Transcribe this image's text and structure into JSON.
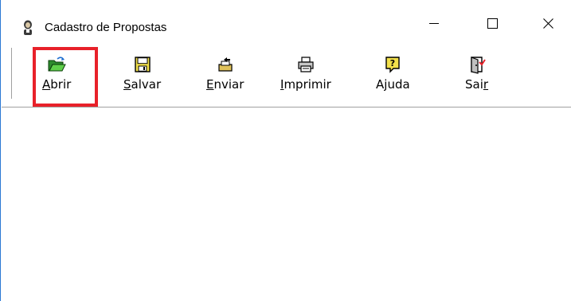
{
  "window": {
    "title": "Cadastro de Propostas",
    "icon": "person-icon"
  },
  "window_controls": {
    "minimize_icon": "minimize-icon",
    "maximize_icon": "maximize-icon",
    "close_icon": "close-icon"
  },
  "toolbar": {
    "buttons": [
      {
        "label_mn": "A",
        "label_rest": "brir",
        "icon": "folder-open-icon",
        "selected": true
      },
      {
        "label_mn": "S",
        "label_rest": "alvar",
        "icon": "save-icon"
      },
      {
        "label_mn": "E",
        "label_rest": "nviar",
        "icon": "send-icon"
      },
      {
        "label_mn": "I",
        "label_rest": "mprimir",
        "icon": "printer-icon"
      },
      {
        "label_pre": "A",
        "label_mn": "j",
        "label_rest": "uda",
        "icon": "help-icon"
      },
      {
        "label_pre": "Sai",
        "label_mn": "r",
        "label_rest": "",
        "icon": "exit-icon"
      }
    ]
  },
  "colors": {
    "selection_frame": "#e8212a",
    "window_border": "#2b78d4"
  }
}
